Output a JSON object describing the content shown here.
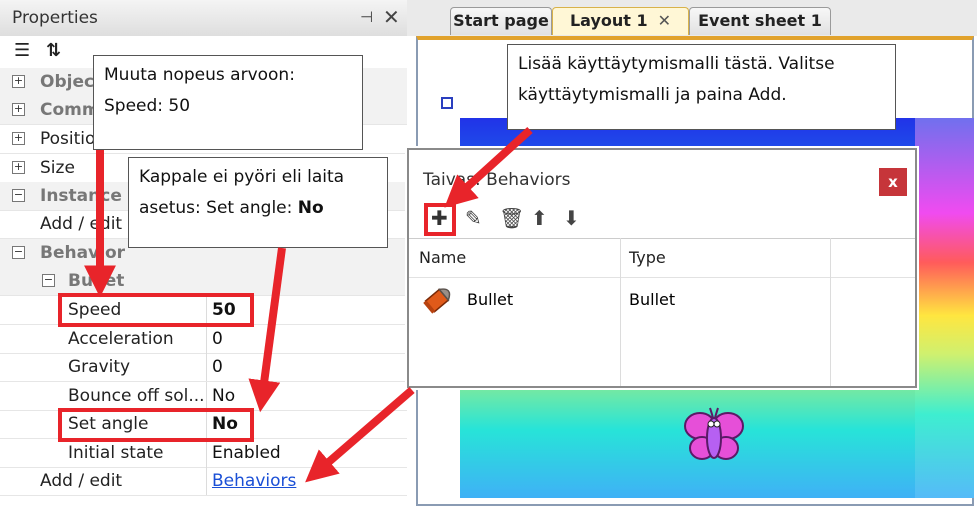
{
  "properties": {
    "title": "Properties",
    "rows": [
      {
        "label": "Objec",
        "kind": "cat-collapsed",
        "value": ""
      },
      {
        "label": "Comm",
        "kind": "cat-collapsed",
        "value": ""
      },
      {
        "label": "Positio",
        "kind": "cat-collapsed-plain",
        "value": ""
      },
      {
        "label": "Size",
        "kind": "cat-collapsed-plain",
        "value": ""
      },
      {
        "label": "Instance v",
        "kind": "cat-expanded",
        "value": ""
      },
      {
        "label": "Add / edit",
        "kind": "prop",
        "value": ""
      },
      {
        "label": "Behavior",
        "kind": "cat-expanded",
        "value": ""
      },
      {
        "label": "Bullet",
        "kind": "subcat",
        "value": ""
      },
      {
        "label": "Speed",
        "kind": "prop2",
        "value": "50"
      },
      {
        "label": "Acceleration",
        "kind": "prop2",
        "value": "0"
      },
      {
        "label": "Gravity",
        "kind": "prop2",
        "value": "0"
      },
      {
        "label": "Bounce off sol...",
        "kind": "prop2",
        "value": "No"
      },
      {
        "label": "Set angle",
        "kind": "prop2",
        "value": "No"
      },
      {
        "label": "Initial state",
        "kind": "prop2",
        "value": "Enabled"
      },
      {
        "label": "Add / edit",
        "kind": "prop",
        "value": "Behaviors"
      }
    ]
  },
  "tabs": [
    {
      "label": "Start page"
    },
    {
      "label": "Layout 1",
      "close": "✕"
    },
    {
      "label": "Event sheet 1"
    }
  ],
  "dialog": {
    "title": "Taivas: Behaviors",
    "close": "x",
    "columns": [
      "Name",
      "Type"
    ],
    "rows": [
      {
        "name": "Bullet",
        "type": "Bullet"
      }
    ]
  },
  "callouts": {
    "speed_line1": "Muuta nopeus arvoon:",
    "speed_line2": "Speed: 50",
    "angle_line1": "Kappale ei pyöri eli laita",
    "angle_line2_prefix": "asetus: Set angle: ",
    "angle_line2_bold": "No",
    "add_line1": "Lisää käyttäytymismalli tästä. Valitse",
    "add_line2": "käyttäytymismalli ja paina Add."
  },
  "colors": {
    "highlight": "#e8242a",
    "link": "#1a4fd6",
    "close_button": "#c6353a"
  }
}
